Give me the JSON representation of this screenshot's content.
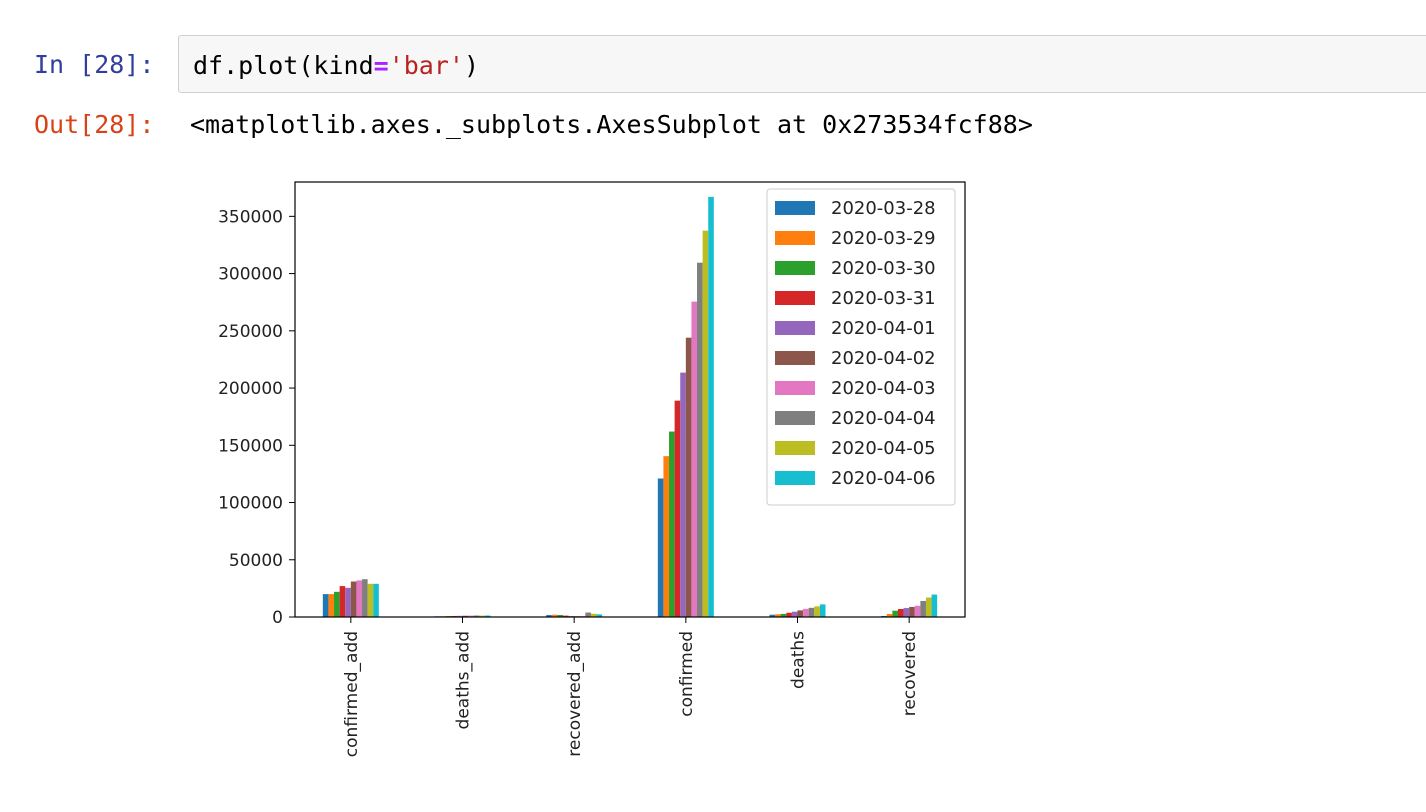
{
  "cell": {
    "in_prompt": "In [28]:",
    "out_prompt": "Out[28]:",
    "code": {
      "fn": "df.plot(kind",
      "op": "=",
      "str": "'bar'",
      "close": ")"
    },
    "output_text": "<matplotlib.axes._subplots.AxesSubplot at 0x273534fcf88>"
  },
  "chart_data": {
    "type": "bar",
    "categories": [
      "confirmed_add",
      "deaths_add",
      "recovered_add",
      "confirmed",
      "deaths",
      "recovered"
    ],
    "ylim": [
      0,
      380000
    ],
    "yticks": [
      0,
      50000,
      100000,
      150000,
      200000,
      250000,
      300000,
      350000
    ],
    "legend_position": "top-right",
    "grid": false,
    "series": [
      {
        "name": "2020-03-28",
        "color": "#1f77b4",
        "values": [
          20000,
          600,
          1700,
          121000,
          2000,
          900
        ]
      },
      {
        "name": "2020-03-29",
        "color": "#ff7f0e",
        "values": [
          20000,
          700,
          2000,
          140500,
          2400,
          2600
        ]
      },
      {
        "name": "2020-03-30",
        "color": "#2ca02c",
        "values": [
          22000,
          800,
          1800,
          162000,
          2700,
          5500
        ]
      },
      {
        "name": "2020-03-31",
        "color": "#d62728",
        "values": [
          27000,
          900,
          1200,
          189000,
          3700,
          7000
        ]
      },
      {
        "name": "2020-04-01",
        "color": "#9467bd",
        "values": [
          25500,
          1000,
          800,
          213500,
          4600,
          7800
        ]
      },
      {
        "name": "2020-04-02",
        "color": "#8c564b",
        "values": [
          31000,
          1100,
          700,
          244000,
          5800,
          8800
        ]
      },
      {
        "name": "2020-04-03",
        "color": "#e377c2",
        "values": [
          32000,
          1200,
          800,
          275500,
          7100,
          9800
        ]
      },
      {
        "name": "2020-04-04",
        "color": "#7f7f7f",
        "values": [
          33000,
          1300,
          3900,
          309500,
          8000,
          14000
        ]
      },
      {
        "name": "2020-04-05",
        "color": "#bcbd22",
        "values": [
          29000,
          1200,
          2800,
          337500,
          9300,
          17000
        ]
      },
      {
        "name": "2020-04-06",
        "color": "#17becf",
        "values": [
          29000,
          1300,
          2300,
          367000,
          11000,
          19600
        ]
      }
    ]
  }
}
